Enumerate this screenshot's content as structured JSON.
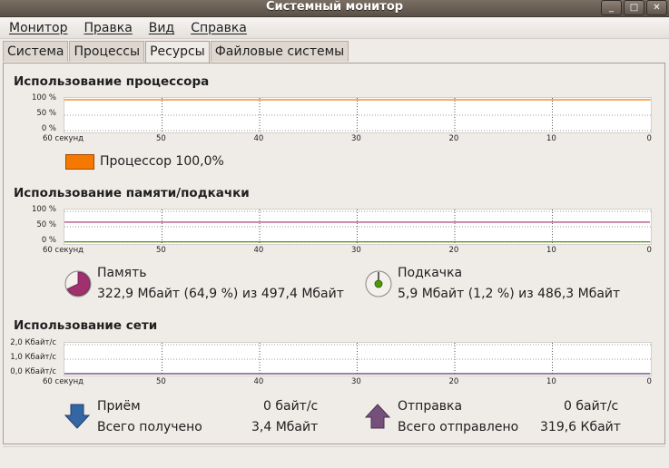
{
  "window": {
    "title": "Системный монитор",
    "buttons": [
      "_",
      "□",
      "✕"
    ]
  },
  "menubar": {
    "items": [
      "Монитор",
      "Правка",
      "Вид",
      "Справка"
    ]
  },
  "tabs": {
    "items": [
      "Система",
      "Процессы",
      "Ресурсы",
      "Файловые системы"
    ],
    "active": 2
  },
  "cpu": {
    "title": "Использование процессора",
    "legend_label": "Процессор 100,0%",
    "color": "#f57900"
  },
  "memory": {
    "title": "Использование памяти/подкачки",
    "mem_label": "Память",
    "mem_value": "322,9 Мбайт (64,9 %) из 497,4 Мбайт",
    "mem_color": "#a0306e",
    "swap_label": "Подкачка",
    "swap_value": "5,9 Мбайт (1,2 %) из 486,3 Мбайт",
    "swap_color": "#4e9a06"
  },
  "network": {
    "title": "Использование сети",
    "recv_label": "Приём",
    "recv_rate": "0 байт/с",
    "recv_total_label": "Всего получено",
    "recv_total": "3,4 Мбайт",
    "send_label": "Отправка",
    "send_rate": "0 байт/с",
    "send_total_label": "Всего отправлено",
    "send_total": "319,6 Кбайт",
    "recv_color": "#3465a4",
    "send_color": "#75507b"
  },
  "chart_data": [
    {
      "type": "line",
      "name": "cpu",
      "title": "Использование процессора",
      "x": [
        60,
        50,
        40,
        30,
        20,
        10,
        0
      ],
      "xlabels": [
        "60 секунд",
        "50",
        "40",
        "30",
        "20",
        "10",
        "0"
      ],
      "yticks": [
        "100 %",
        "50 %",
        "0 %"
      ],
      "ylim": [
        0,
        100
      ],
      "series": [
        {
          "name": "Процессор",
          "values": [
            100,
            100,
            100,
            100,
            100,
            100,
            100
          ],
          "color": "#f57900"
        }
      ]
    },
    {
      "type": "line",
      "name": "memory",
      "title": "Использование памяти/подкачки",
      "x": [
        60,
        50,
        40,
        30,
        20,
        10,
        0
      ],
      "xlabels": [
        "60 секунд",
        "50",
        "40",
        "30",
        "20",
        "10",
        "0"
      ],
      "yticks": [
        "100 %",
        "50 %",
        "0 %"
      ],
      "ylim": [
        0,
        100
      ],
      "series": [
        {
          "name": "Память",
          "values": [
            64.9,
            64.9,
            64.9,
            64.9,
            64.9,
            64.9,
            64.9
          ],
          "color": "#a0306e"
        },
        {
          "name": "Подкачка",
          "values": [
            1.2,
            1.2,
            1.2,
            1.2,
            1.2,
            1.2,
            1.2
          ],
          "color": "#4e9a06"
        }
      ]
    },
    {
      "type": "line",
      "name": "network",
      "title": "Использование сети",
      "x": [
        60,
        50,
        40,
        30,
        20,
        10,
        0
      ],
      "xlabels": [
        "60 секунд",
        "50",
        "40",
        "30",
        "20",
        "10",
        "0"
      ],
      "yticks": [
        "2,0 Кбайт/с",
        "1,0 Кбайт/с",
        "0,0 Кбайт/с"
      ],
      "ylim": [
        0,
        2
      ],
      "series": [
        {
          "name": "Приём",
          "values": [
            0,
            0,
            0,
            0,
            0,
            0,
            0
          ],
          "color": "#3465a4"
        },
        {
          "name": "Отправка",
          "values": [
            0,
            0,
            0,
            0,
            0,
            0,
            0
          ],
          "color": "#75507b"
        }
      ]
    }
  ]
}
